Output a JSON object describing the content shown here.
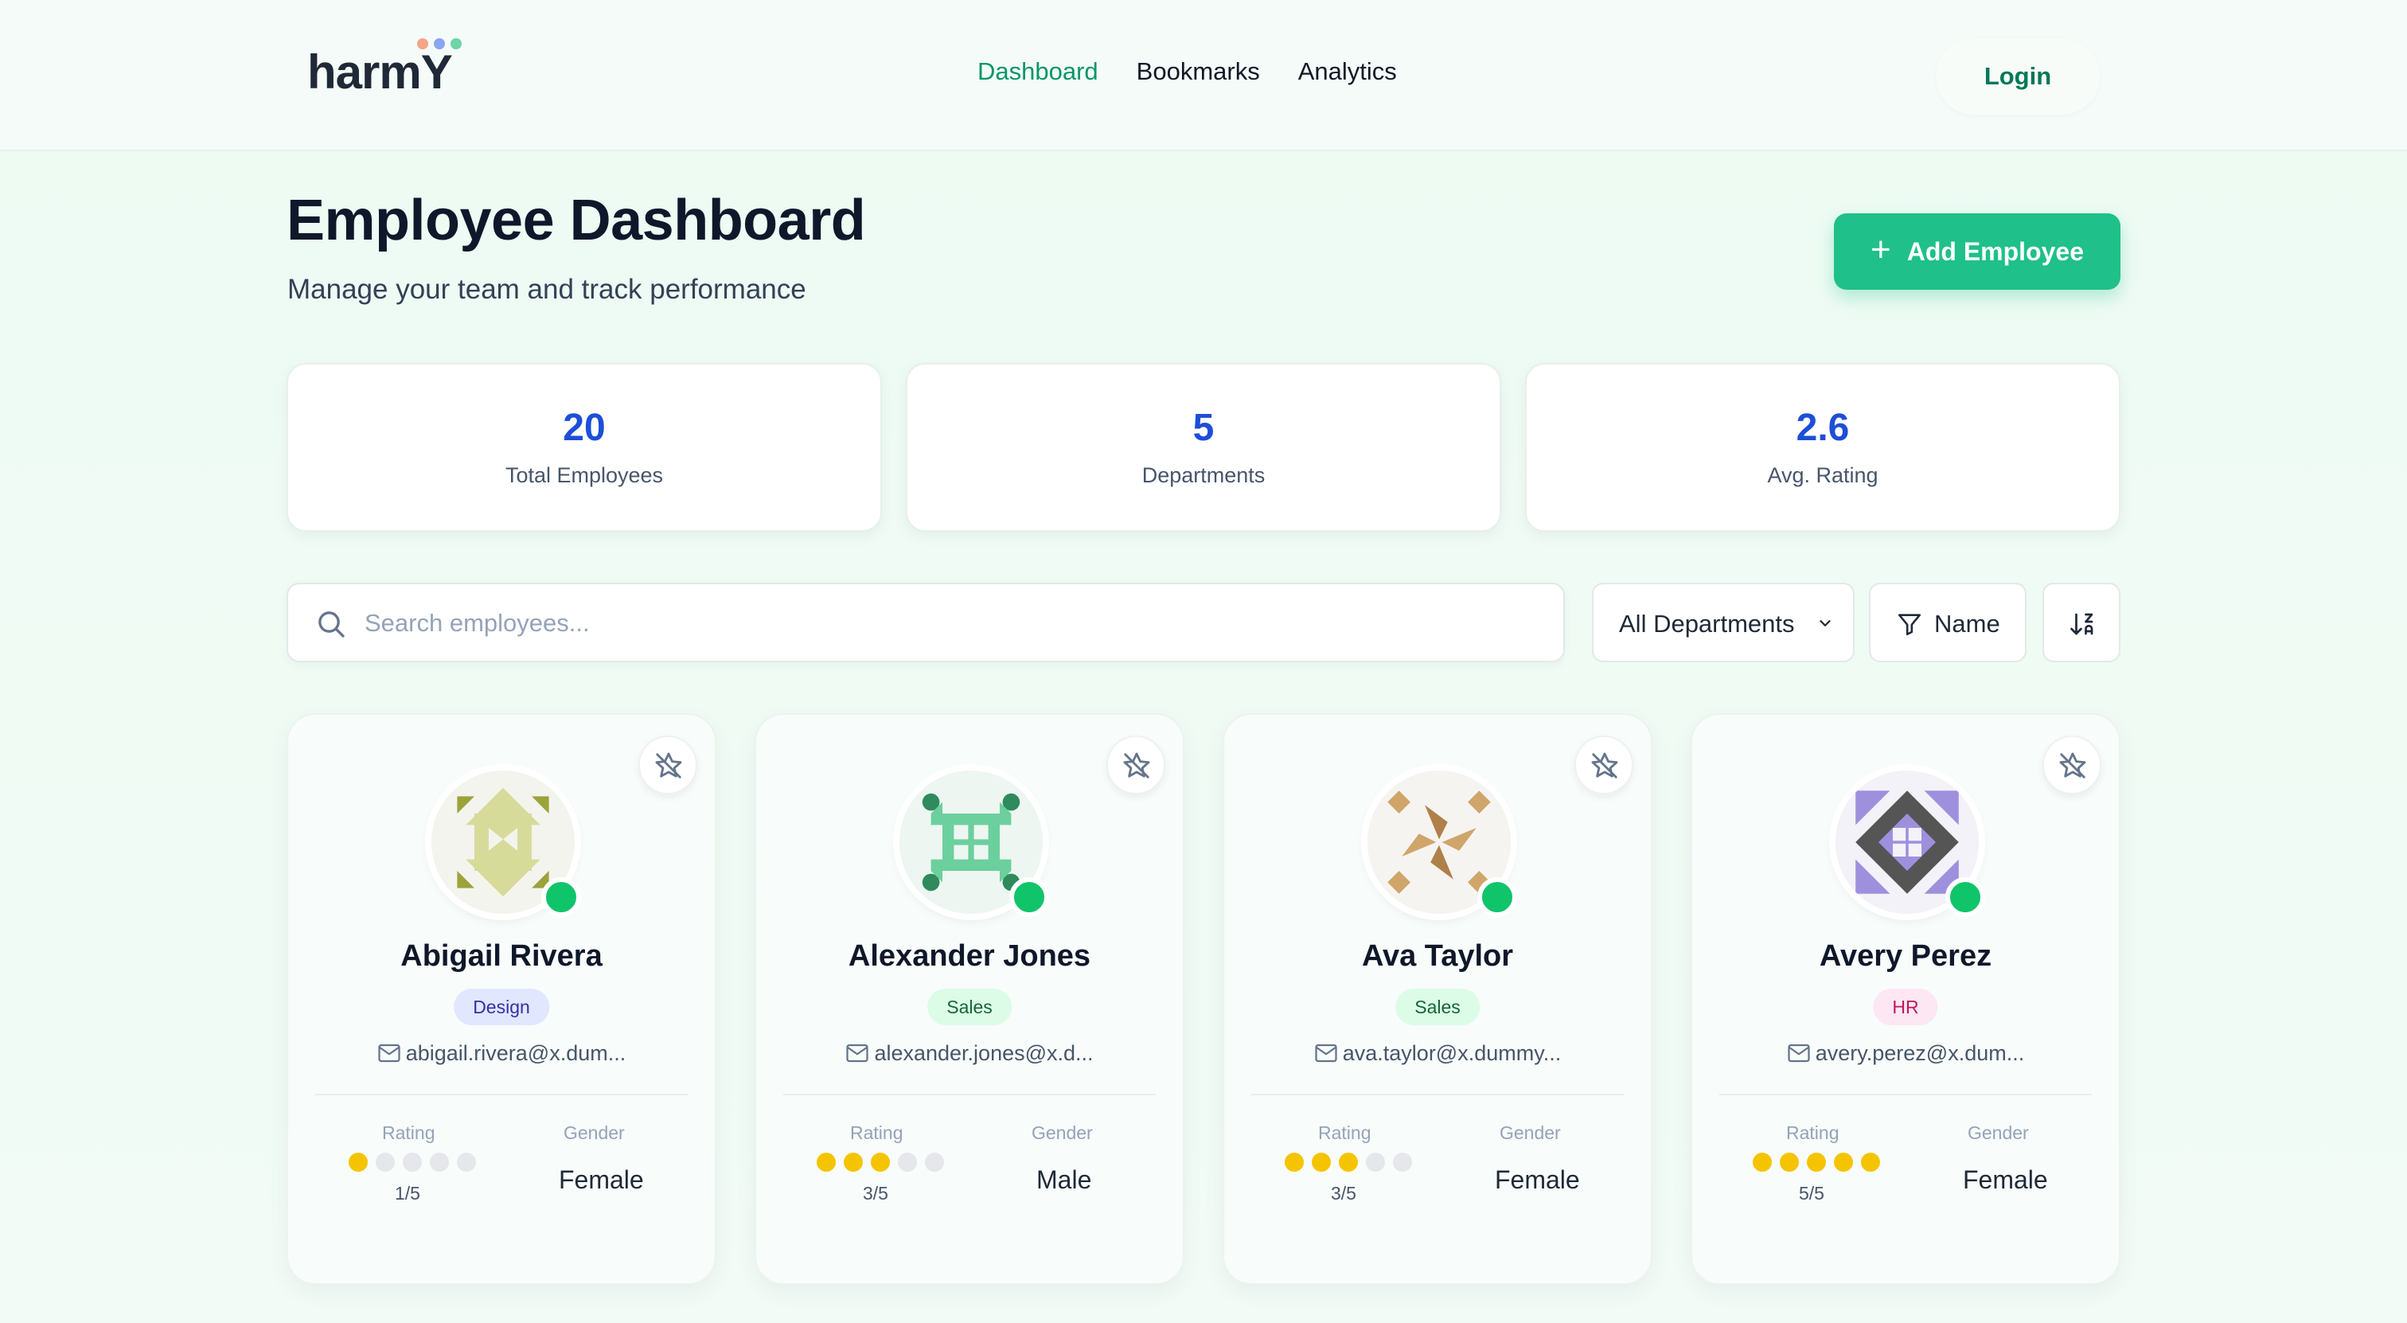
{
  "header": {
    "logo_text": "harmY",
    "logo_dot_colors": [
      "#f4a58a",
      "#8aa5f4",
      "#6dd5a8"
    ],
    "nav": [
      {
        "label": "Dashboard",
        "active": true
      },
      {
        "label": "Bookmarks",
        "active": false
      },
      {
        "label": "Analytics",
        "active": false
      }
    ],
    "login_label": "Login"
  },
  "page": {
    "title": "Employee Dashboard",
    "subtitle": "Manage your team and track performance",
    "add_button_label": "Add Employee",
    "add_button_icon": "plus-icon"
  },
  "stats": [
    {
      "value": "20",
      "label": "Total Employees"
    },
    {
      "value": "5",
      "label": "Departments"
    },
    {
      "value": "2.6",
      "label": "Avg. Rating"
    }
  ],
  "filters": {
    "search_placeholder": "Search employees...",
    "search_value": "",
    "department_selected": "All Departments",
    "sort_field_label": "Name",
    "sort_icon": "sort-direction-icon"
  },
  "labels": {
    "rating": "Rating",
    "gender": "Gender"
  },
  "employees": [
    {
      "name": "Abigail Rivera",
      "department": "Design",
      "email": "abigail.rivera@x.dum...",
      "rating": 1,
      "rating_text": "1/5",
      "gender": "Female",
      "online": true,
      "badge_bg": "#e0e7ff",
      "badge_fg": "#3730a3",
      "avatar_colors": [
        "#d7db9a",
        "#9ca33a",
        "#f4f4ee"
      ]
    },
    {
      "name": "Alexander Jones",
      "department": "Sales",
      "email": "alexander.jones@x.d...",
      "rating": 3,
      "rating_text": "3/5",
      "gender": "Male",
      "online": true,
      "badge_bg": "#dcfce7",
      "badge_fg": "#166534",
      "avatar_colors": [
        "#6ccf9e",
        "#2f8a5c",
        "#eef6f1"
      ]
    },
    {
      "name": "Ava Taylor",
      "department": "Sales",
      "email": "ava.taylor@x.dummy...",
      "rating": 3,
      "rating_text": "3/5",
      "gender": "Female",
      "online": true,
      "badge_bg": "#dcfce7",
      "badge_fg": "#166534",
      "avatar_colors": [
        "#d0a56a",
        "#b0804a",
        "#f6f4f1"
      ]
    },
    {
      "name": "Avery Perez",
      "department": "HR",
      "email": "avery.perez@x.dum...",
      "rating": 5,
      "rating_text": "5/5",
      "gender": "Female",
      "online": true,
      "badge_bg": "#fce7f3",
      "badge_fg": "#be185d",
      "avatar_colors": [
        "#9f90de",
        "#555555",
        "#f3f2f8"
      ]
    }
  ]
}
